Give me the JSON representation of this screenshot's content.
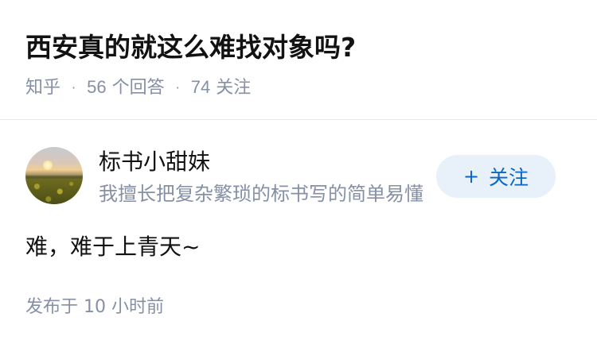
{
  "question": {
    "title": "西安真的就这么难找对象吗?",
    "meta": {
      "source": "知乎",
      "answer_count": "56",
      "answer_label": "个回答",
      "follower_count": "74",
      "follower_label": "关注",
      "separator": "·"
    }
  },
  "answer": {
    "author": {
      "name": "标书小甜妹",
      "bio": "我擅长把复杂繁琐的标书写的简单易懂"
    },
    "follow_button": {
      "icon": "+",
      "label": "关注"
    },
    "content": "难，难于上青天~",
    "time": "发布于 10 小时前"
  },
  "colors": {
    "title": "#121212",
    "meta": "#8590a6",
    "follow_bg": "#e8f0fa",
    "follow_text": "#0a66c2",
    "divider": "#ebebeb"
  }
}
